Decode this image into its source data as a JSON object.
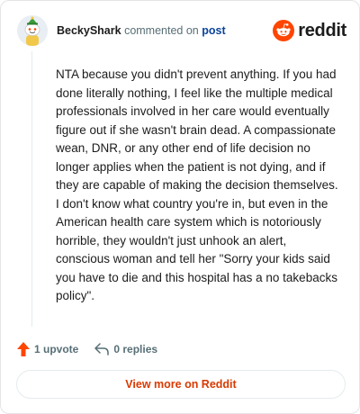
{
  "comment": {
    "author": "BeckyShark",
    "action_text": "commented on",
    "post_link": "post",
    "body": "NTA because you didn't prevent anything. If you had done literally nothing, I feel like the multiple medical professionals involved in her care would eventually figure out if she wasn't brain dead. A compassionate wean, DNR, or any other end of life decision no longer applies when the patient is not dying, and if they are capable of making the decision themselves. I don't know what country you're in, but even in the American health care system which is notoriously horrible, they wouldn't just unhook an alert, conscious woman and tell her \"Sorry your kids said you have to die and this hospital has a no takebacks policy\"."
  },
  "brand": {
    "name": "reddit",
    "color": "#ff4500"
  },
  "actions": {
    "upvotes": "1 upvote",
    "replies": "0 replies"
  },
  "footer": {
    "view_more_label": "View more on Reddit"
  },
  "colors": {
    "accent": "#d93a00",
    "link": "#0a449b",
    "muted": "#576f76",
    "upvote": "#ff4500"
  },
  "icons": {
    "avatar": "snoo-avatar-icon",
    "logo": "reddit-logo-icon",
    "upvote": "upvote-arrow-icon",
    "reply": "reply-arrow-icon"
  }
}
